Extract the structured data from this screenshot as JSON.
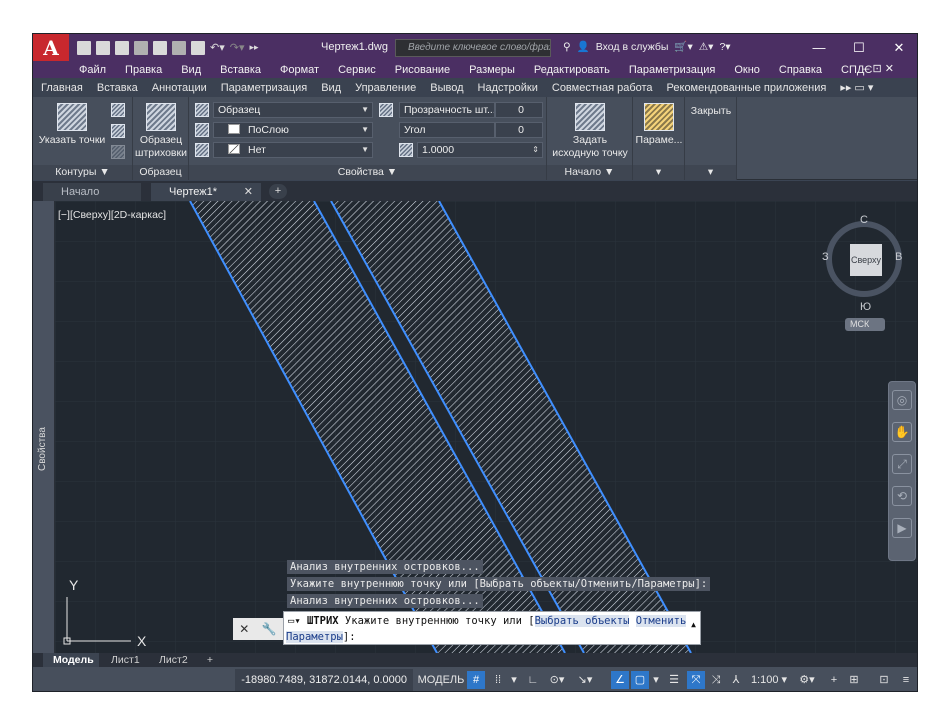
{
  "title_bar": {
    "app_letter": "A",
    "document_title": "Чертеж1.dwg",
    "search_placeholder": "Введите ключевое слово/фразу",
    "signin_label": "Вход в службы",
    "minimize": "—",
    "maximize": "☐",
    "close": "✕"
  },
  "menu": {
    "items": [
      "Файл",
      "Правка",
      "Вид",
      "Вставка",
      "Формат",
      "Сервис",
      "Рисование",
      "Размеры",
      "Редактировать",
      "Параметризация",
      "Окно",
      "Справка",
      "СПДС"
    ],
    "window_controls": "– ⊡ ✕"
  },
  "ribbon_tabs": [
    "Главная",
    "Вставка",
    "Аннотации",
    "Параметризация",
    "Вид",
    "Управление",
    "Вывод",
    "Надстройки",
    "Совместная работа",
    "Рекомендованные приложения"
  ],
  "ribbon_tabs_more": "▸▸ ▭ ▾",
  "ribbon": {
    "pick_points": "Указать точки",
    "contours": "Контуры ▼",
    "hatch_pattern": "Образец штриховки",
    "pattern_panel": "Образец",
    "pattern_dropdown": "Образец",
    "color_dropdown": "ПоСлою",
    "bg_dropdown": "Нет",
    "transparency_label": "Прозрачность шт...",
    "transparency_value": "0",
    "angle_label": "Угол",
    "angle_value": "0",
    "scale_value": "1.0000",
    "properties_panel": "Свойства ▼",
    "set_origin": "Задать исходную точку",
    "origin_panel": "Начало ▼",
    "options": "Параме...",
    "close": "Закрыть"
  },
  "doc_tabs": {
    "start": "Начало",
    "drawing": "Чертеж1*",
    "close": "✕",
    "add": "+"
  },
  "properties_strip": "Свойства",
  "viewport_label": "[−][Сверху][2D-каркас]",
  "viewcube": {
    "top": "Сверху",
    "north": "С",
    "south": "Ю",
    "west": "З",
    "east": "В",
    "ucs": "МСК"
  },
  "command_history": [
    "Анализ внутренних островков...",
    "Укажите внутреннюю точку или [Выбрать объекты/Отменить/Параметры]:",
    "Анализ внутренних островков..."
  ],
  "command_line": {
    "prompt_icon": "▭▾",
    "command": "ШТРИХ",
    "text": "Укажите внутреннюю точку или [",
    "opt1": "Выбрать объекты",
    "opt2": "Отменить",
    "opt3": "Параметры",
    "tail": "]:"
  },
  "ucs_icon": {
    "x": "X",
    "y": "Y"
  },
  "layout_tabs": [
    "Модель",
    "Лист1",
    "Лист2"
  ],
  "layout_add": "+",
  "status": {
    "coordinates": "-18980.7489, 31872.0144, 0.0000",
    "model": "МОДЕЛЬ",
    "scale": "1:100 ▾"
  }
}
